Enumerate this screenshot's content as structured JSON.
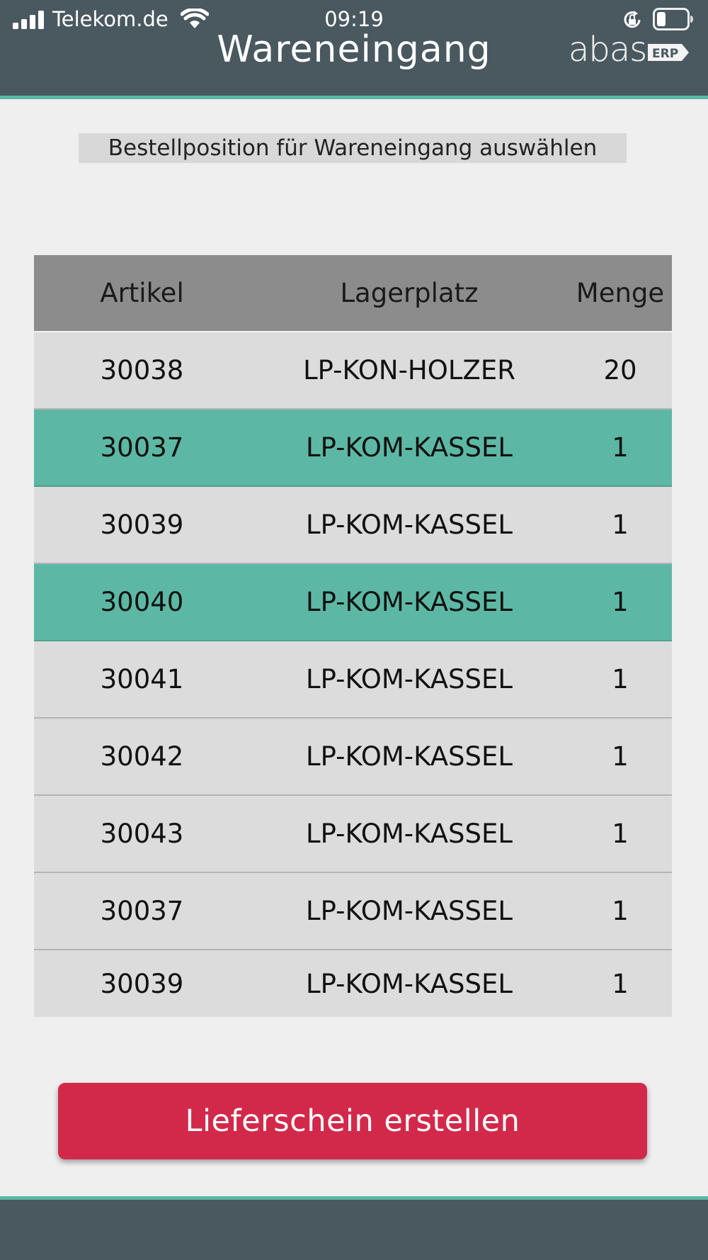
{
  "status_bar": {
    "carrier": "Telekom.de",
    "time": "09:19"
  },
  "header": {
    "title": "Wareneingang",
    "logo_text": "abas",
    "logo_tag": "ERP"
  },
  "subtitle": "Bestellposition für Wareneingang auswählen",
  "table": {
    "columns": [
      "Artikel",
      "Lagerplatz",
      "Menge"
    ],
    "rows": [
      {
        "artikel": "30038",
        "lagerplatz": "LP-KON-HOLZER",
        "menge": "20",
        "selected": false
      },
      {
        "artikel": "30037",
        "lagerplatz": "LP-KOM-KASSEL",
        "menge": "1",
        "selected": true
      },
      {
        "artikel": "30039",
        "lagerplatz": "LP-KOM-KASSEL",
        "menge": "1",
        "selected": false
      },
      {
        "artikel": "30040",
        "lagerplatz": "LP-KOM-KASSEL",
        "menge": "1",
        "selected": true
      },
      {
        "artikel": "30041",
        "lagerplatz": "LP-KOM-KASSEL",
        "menge": "1",
        "selected": false
      },
      {
        "artikel": "30042",
        "lagerplatz": "LP-KOM-KASSEL",
        "menge": "1",
        "selected": false
      },
      {
        "artikel": "30043",
        "lagerplatz": "LP-KOM-KASSEL",
        "menge": "1",
        "selected": false
      },
      {
        "artikel": "30037",
        "lagerplatz": "LP-KOM-KASSEL",
        "menge": "1",
        "selected": false
      },
      {
        "artikel": "30039",
        "lagerplatz": "LP-KOM-KASSEL",
        "menge": "1",
        "selected": false
      }
    ]
  },
  "action": {
    "create_delivery_note_label": "Lieferschein erstellen"
  },
  "colors": {
    "header_bg": "#4a5860",
    "accent_teal": "#5cb8a4",
    "button_red": "#d2294a",
    "row_bg": "#dcdcdc",
    "header_row_bg": "#8c8c8c"
  },
  "icons": [
    "signal-icon",
    "wifi-icon",
    "rotation-lock-icon",
    "battery-icon"
  ]
}
